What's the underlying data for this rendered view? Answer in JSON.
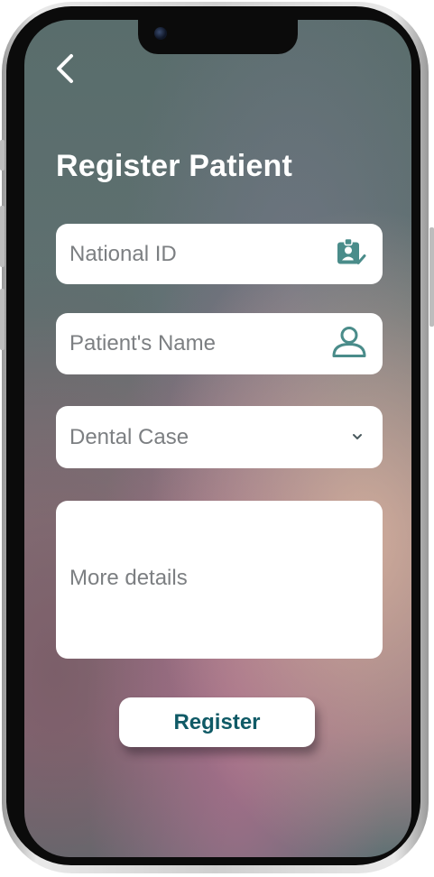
{
  "header": {
    "back_icon": "chevron-left-icon",
    "title": "Register Patient"
  },
  "form": {
    "national_id": {
      "placeholder": "National ID",
      "icon": "id-badge-check-icon"
    },
    "patient_name": {
      "placeholder": "Patient's Name",
      "icon": "user-icon"
    },
    "dental_case": {
      "selected": "Dental Case",
      "icon": "chevron-down-icon"
    },
    "details": {
      "placeholder": "More details"
    },
    "submit_label": "Register"
  },
  "colors": {
    "accent": "#0f5a66",
    "icon_teal": "#4a8c8a",
    "field_bg": "#ffffff",
    "title": "#ffffff"
  }
}
